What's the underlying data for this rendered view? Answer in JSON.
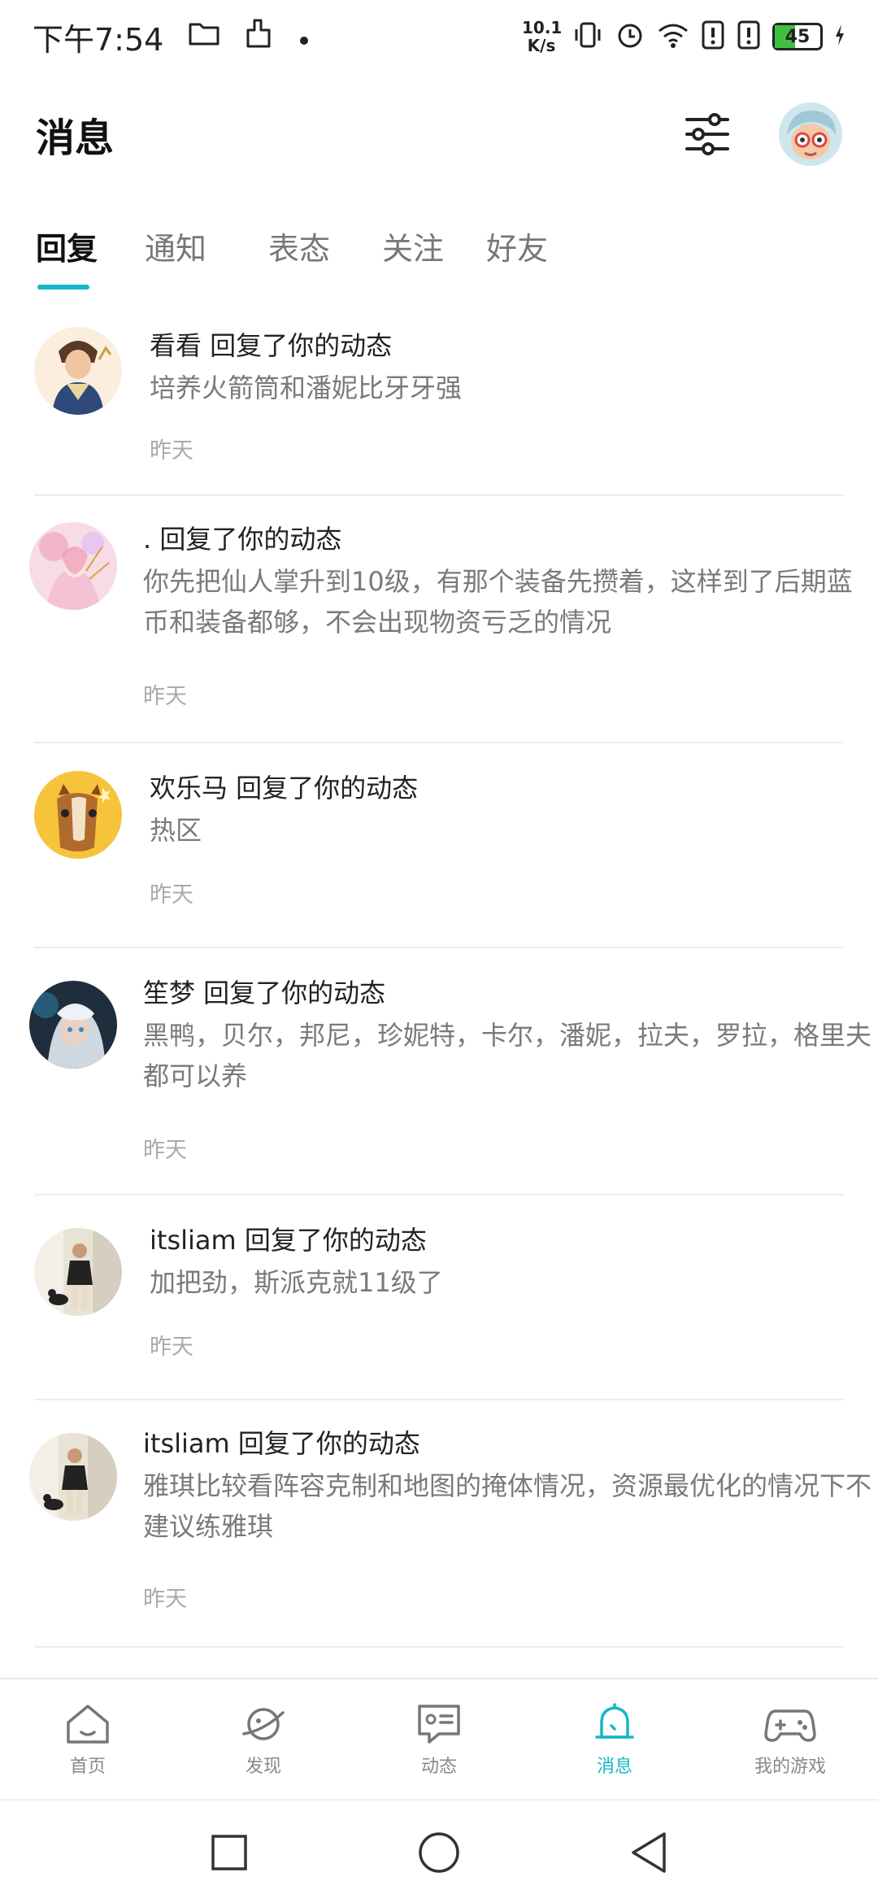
{
  "status_bar": {
    "time": "下午7:54",
    "net_speed_value": "10.1",
    "net_speed_unit": "K/s",
    "battery": "45",
    "battery_level": 0.45
  },
  "header": {
    "title": "消息"
  },
  "tabs": [
    {
      "label": "回复",
      "active": true
    },
    {
      "label": "通知",
      "active": false
    },
    {
      "label": "表态",
      "active": false
    },
    {
      "label": "关注",
      "active": false
    },
    {
      "label": "好友",
      "active": false
    }
  ],
  "messages": [
    {
      "title": "看看 回复了你的动态",
      "content": "培养火箭筒和潘妮比牙牙强",
      "time": "昨天"
    },
    {
      "title": ". 回复了你的动态",
      "content": "你先把仙人掌升到10级，有那个装备先攒着，这样到了后期蓝币和装备都够，不会出现物资亏乏的情况",
      "time": "昨天"
    },
    {
      "title": "欢乐马 回复了你的动态",
      "content": "热区",
      "time": "昨天"
    },
    {
      "title": "笙梦 回复了你的动态",
      "content": "黑鸭，贝尔，邦尼，珍妮特，卡尔，潘妮，拉夫，罗拉，格里夫都可以养",
      "time": "昨天"
    },
    {
      "title": "itsliam 回复了你的动态",
      "content": "加把劲，斯派克就11级了",
      "time": "昨天"
    },
    {
      "title": "itsliam 回复了你的动态",
      "content": "雅琪比较看阵容克制和地图的掩体情况，资源最优化的情况下不建议练雅琪",
      "time": "昨天"
    }
  ],
  "bottom_nav": [
    {
      "label": "首页",
      "icon": "home-icon",
      "active": false
    },
    {
      "label": "发现",
      "icon": "planet-icon",
      "active": false
    },
    {
      "label": "动态",
      "icon": "feed-icon",
      "active": false
    },
    {
      "label": "消息",
      "icon": "bell-icon",
      "active": true
    },
    {
      "label": "我的游戏",
      "icon": "gamepad-icon",
      "active": false
    }
  ],
  "colors": {
    "accent": "#14b8c6",
    "battery": "#3fbf3f"
  }
}
